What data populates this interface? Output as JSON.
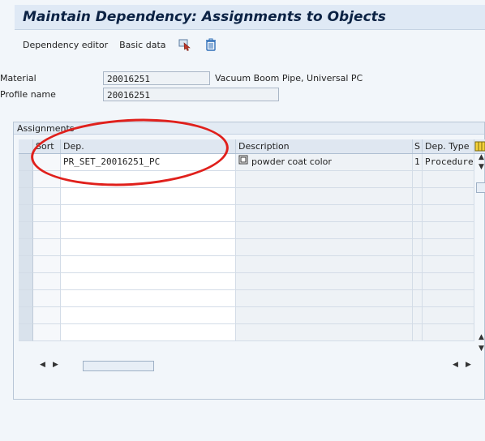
{
  "title": "Maintain Dependency: Assignments to Objects",
  "toolbar": {
    "dependency_editor": "Dependency editor",
    "basic_data": "Basic data"
  },
  "header": {
    "material_label": "Material",
    "material_value": "20016251",
    "material_text": "Vacuum Boom Pipe, Universal PC",
    "profile_label": "Profile name",
    "profile_value": "20016251"
  },
  "assignments": {
    "group_title": "Assignments",
    "columns": [
      "Sort",
      "Dep.",
      "Description",
      "S",
      "Dep. Type"
    ],
    "rows": [
      {
        "sort": "",
        "dep": "PR_SET_20016251_PC",
        "description": "powder coat color",
        "s": "1",
        "type": "Procedure"
      }
    ],
    "empty_rows": 10
  },
  "colors": {
    "title_text": "#0b2244",
    "highlight_circle": "#e0201c"
  }
}
